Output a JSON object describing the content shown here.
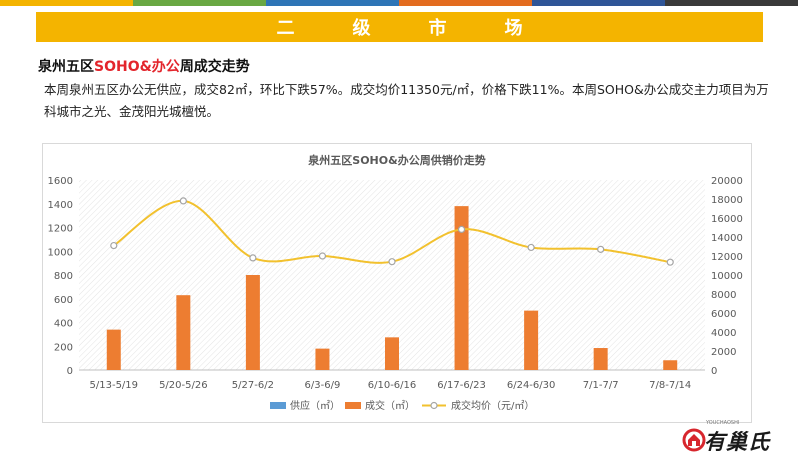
{
  "header": {
    "banner_title": "二级市场",
    "strip_colors": [
      "#f4b400",
      "#69a843",
      "#2e75b6",
      "#e36c1f",
      "#2f5597",
      "#3a3a3a"
    ]
  },
  "section": {
    "title_prefix": "泉州五区",
    "title_highlight": "SOHO&办公",
    "title_suffix": "周成交走势",
    "summary": "本周泉州五区办公无供应，成交82㎡，环比下跌57%。成交均价11350元/㎡，价格下跌11%。本周SOHO&办公成交主力项目为万科城市之光、金茂阳光城檀悦。"
  },
  "colors": {
    "accent": "#f4b400",
    "highlight": "#e3252c",
    "supply": "#5b9bd5",
    "deal": "#ed7d31",
    "price": "#f2c12e"
  },
  "chart_data": {
    "type": "bar",
    "title": "泉州五区SOHO&办公周供销价走势",
    "categories": [
      "5/13-5/19",
      "5/20-5/26",
      "5/27-6/2",
      "6/3-6/9",
      "6/10-6/16",
      "6/17-6/23",
      "6/24-6/30",
      "7/1-7/7",
      "7/8-7/14"
    ],
    "series": [
      {
        "name": "供应（㎡）",
        "type": "bar",
        "axis": "left",
        "values": [
          0,
          0,
          0,
          0,
          0,
          0,
          0,
          0,
          0
        ]
      },
      {
        "name": "成交（㎡）",
        "type": "bar",
        "axis": "left",
        "values": [
          340,
          630,
          800,
          180,
          275,
          1380,
          500,
          185,
          82
        ]
      },
      {
        "name": "成交均价（元/㎡）",
        "type": "line",
        "axis": "right",
        "values": [
          13100,
          17800,
          11800,
          12000,
          11400,
          14800,
          12900,
          12700,
          11350
        ]
      }
    ],
    "y_left": {
      "min": 0,
      "max": 1600,
      "ticks": [
        0,
        200,
        400,
        600,
        800,
        1000,
        1200,
        1400,
        1600
      ]
    },
    "y_right": {
      "min": 0,
      "max": 20000,
      "ticks": [
        0,
        2000,
        4000,
        6000,
        8000,
        10000,
        12000,
        14000,
        16000,
        18000,
        20000
      ]
    },
    "legend": "bottom",
    "grid": "hatched-background"
  },
  "brand": {
    "logo_text": "有巢氏",
    "logo_sub": "YOUCHAOSHI"
  }
}
